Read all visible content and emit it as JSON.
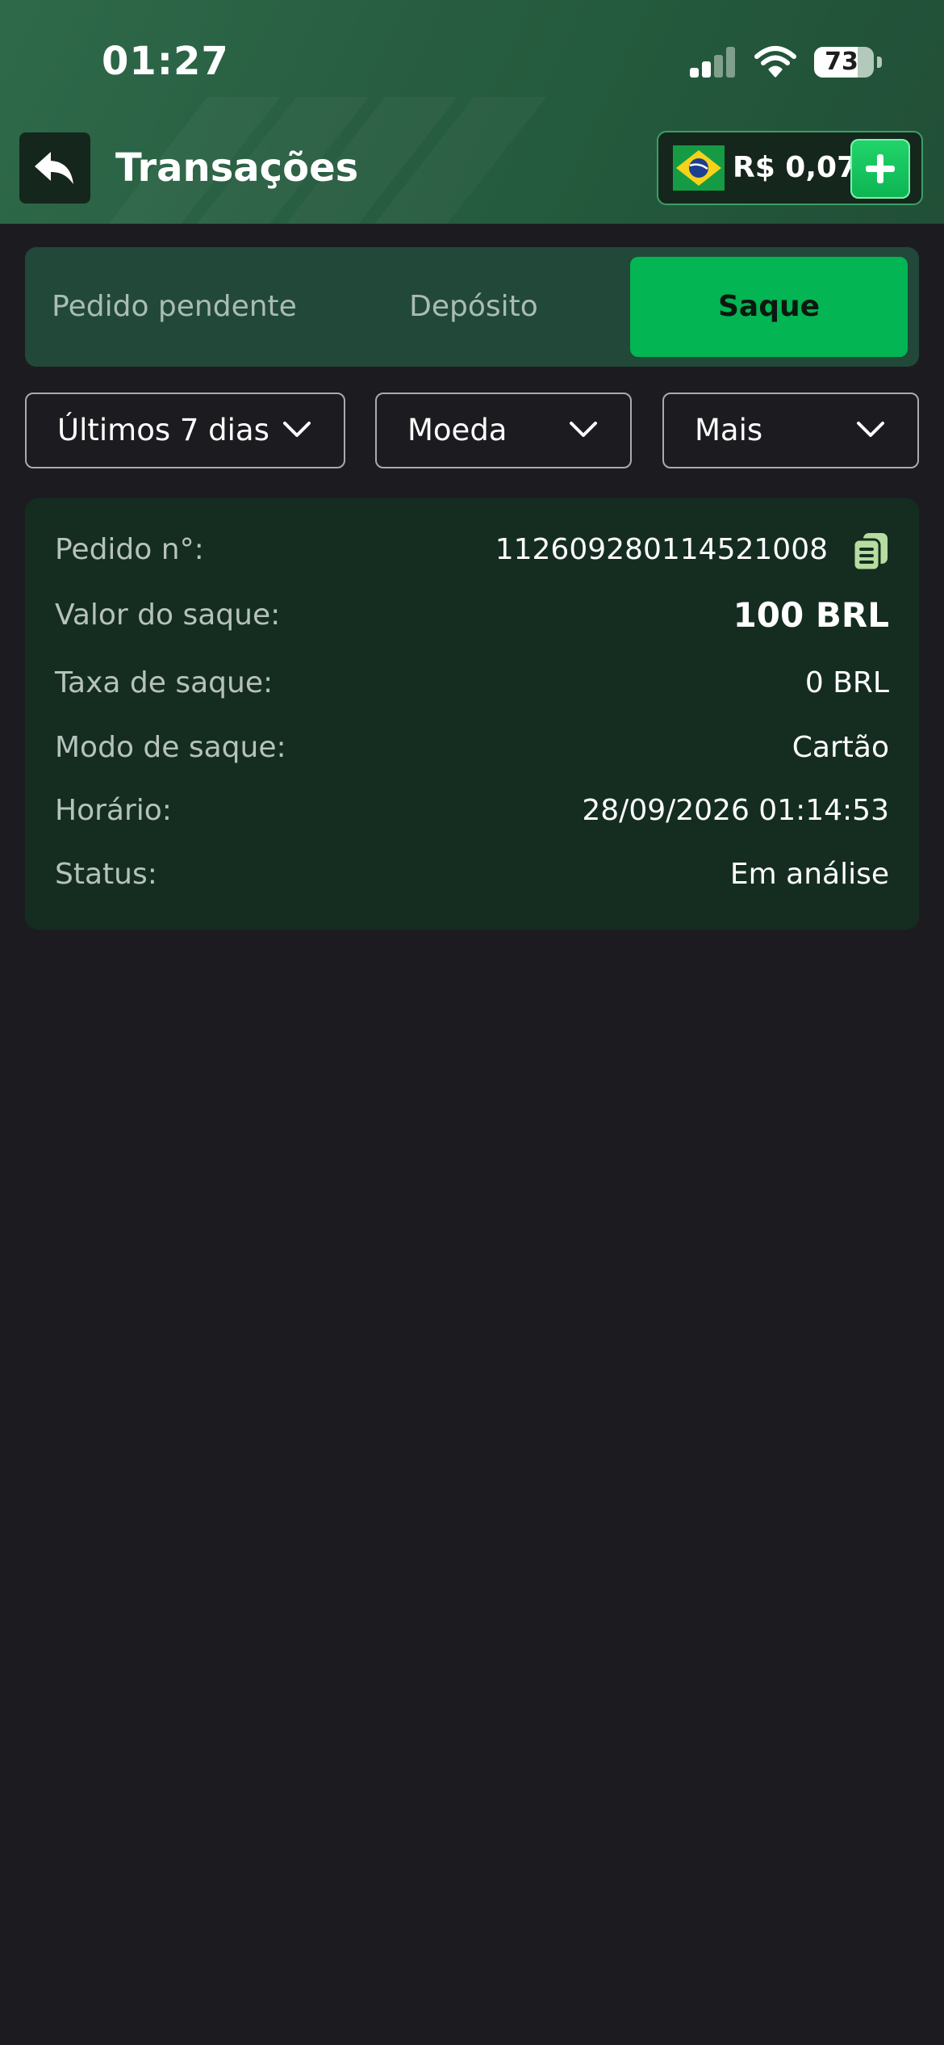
{
  "status_bar": {
    "time": "01:27",
    "battery": "73",
    "battery_level": 0.73
  },
  "header": {
    "title": "Transações",
    "balance": "R$ 0,07"
  },
  "tabs": [
    {
      "label": "Pedido pendente",
      "active": false
    },
    {
      "label": "Depósito",
      "active": false
    },
    {
      "label": "Saque",
      "active": true
    }
  ],
  "filters": {
    "period": "Últimos 7 dias",
    "currency": "Moeda",
    "more": "Mais"
  },
  "transaction": {
    "order_label": "Pedido n°:",
    "order_value": "112609280114521008",
    "amount_label": "Valor do saque:",
    "amount_value": "100 BRL",
    "fee_label": "Taxa de saque:",
    "fee_value": "0 BRL",
    "mode_label": "Modo de saque:",
    "mode_value": "Cartão",
    "time_label": "Horário:",
    "time_value": "28/09/2026 01:14:53",
    "status_label": "Status:",
    "status_value": "Em análise"
  },
  "icons": {
    "back": "back-arrow-icon",
    "add": "plus-icon",
    "flag": "brazil-flag-icon",
    "copy": "copy-icon",
    "dropdown": "chevron-down-icon"
  },
  "colors": {
    "accent": "#03b553",
    "header": "#285d41",
    "background": "#1c1c20",
    "card": "#152d21",
    "tabs_bg": "#22483a"
  }
}
